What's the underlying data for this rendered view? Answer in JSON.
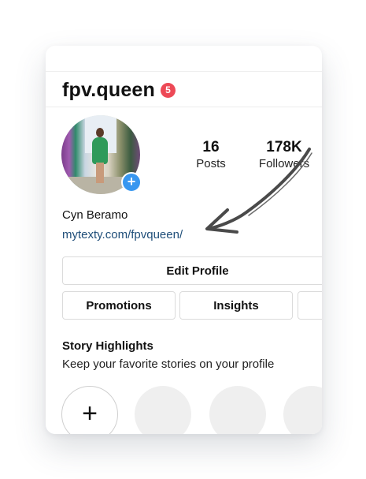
{
  "profile": {
    "username": "fpv.queen",
    "notification_count": "5",
    "display_name": "Cyn Beramo",
    "link": "mytexty.com/fpvqueen/",
    "add_story_symbol": "+"
  },
  "stats": {
    "posts": {
      "value": "16",
      "label": "Posts"
    },
    "followers": {
      "value": "178K",
      "label": "Followers"
    }
  },
  "buttons": {
    "edit_profile": "Edit Profile",
    "promotions": "Promotions",
    "insights": "Insights"
  },
  "highlights": {
    "title": "Story Highlights",
    "subtitle": "Keep your favorite stories on your profile",
    "new_symbol": "+"
  },
  "colors": {
    "badge": "#ed4956",
    "link": "#1f4e79",
    "accent_blue": "#3897f0",
    "arrow": "#4a4a4a"
  },
  "icons": {
    "avatar_add": "plus-circle-icon",
    "highlight_new": "plus-icon",
    "annotation": "hand-drawn-arrow"
  }
}
